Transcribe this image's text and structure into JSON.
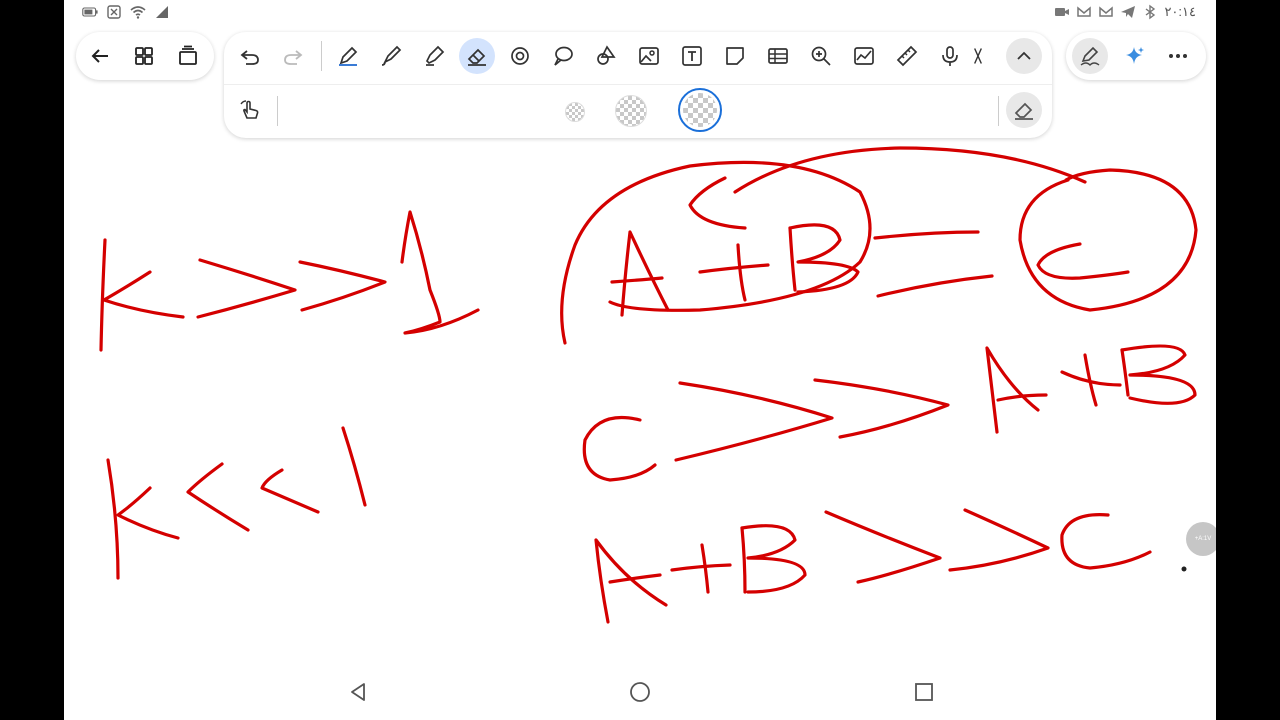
{
  "status_bar": {
    "time": "٢٠:١٤",
    "left_icons": [
      "battery-icon",
      "sim-off-icon",
      "wifi-icon",
      "signal-icon"
    ],
    "right_icons": [
      "camera-icon",
      "gmail-icon",
      "gmail-icon",
      "telegram-icon",
      "bluetooth-icon"
    ]
  },
  "nav_toolbar": {
    "items": [
      "back-arrow-icon",
      "pages-grid-icon",
      "page-view-icon"
    ]
  },
  "main_toolbar": {
    "tools": [
      {
        "name": "undo-icon",
        "active": false
      },
      {
        "name": "redo-icon",
        "active": false
      },
      {
        "name": "pen-icon",
        "active": false
      },
      {
        "name": "brush-icon",
        "active": false
      },
      {
        "name": "highlighter-icon",
        "active": false
      },
      {
        "name": "eraser-icon",
        "active": true
      },
      {
        "name": "lasso-icon",
        "active": false
      },
      {
        "name": "comment-icon",
        "active": false
      },
      {
        "name": "shapes-icon",
        "active": false
      },
      {
        "name": "image-icon",
        "active": false
      },
      {
        "name": "text-icon",
        "active": false
      },
      {
        "name": "sticky-note-icon",
        "active": false
      },
      {
        "name": "table-icon",
        "active": false
      },
      {
        "name": "zoom-icon",
        "active": false
      },
      {
        "name": "chart-icon",
        "active": false
      },
      {
        "name": "ruler-icon",
        "active": false
      },
      {
        "name": "microphone-icon",
        "active": false
      },
      {
        "name": "scissors-icon",
        "active": false
      },
      {
        "name": "collapse-up-icon",
        "active": false
      }
    ],
    "sub_tools": {
      "touch_mode": "finger-touch-icon",
      "eraser_sizes": [
        "small",
        "medium",
        "large"
      ],
      "selected_size": "large",
      "clear": "clear-eraser-icon"
    }
  },
  "right_toolbar": {
    "items": [
      "pen-settings-icon",
      "ai-sparkle-icon",
      "more-icon"
    ]
  },
  "canvas": {
    "ink_color": "#d40000"
  },
  "side_bubble": {
    "label": "+A:1V"
  },
  "nav_bar": {
    "items": [
      "back-triangle-icon",
      "home-circle-icon",
      "recents-square-icon"
    ]
  }
}
